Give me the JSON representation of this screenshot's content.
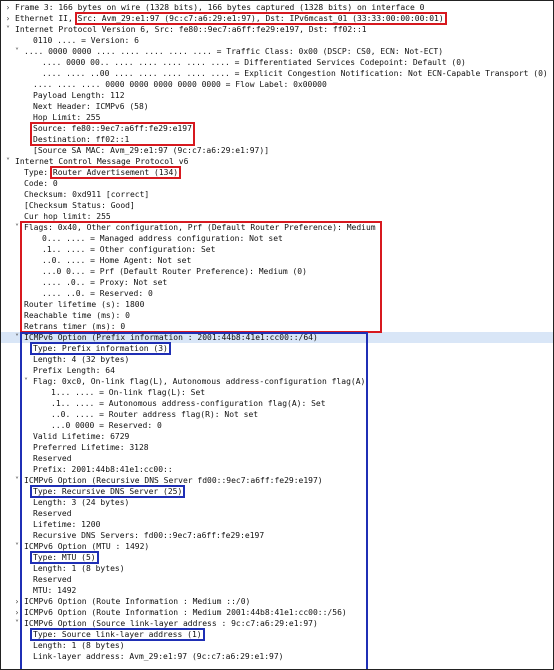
{
  "colors": {
    "highlight_red": "#d7191f",
    "highlight_blue": "#1f2fb5",
    "selected_row": "#d9e6f7"
  },
  "icons": {
    "collapsed": "chevron-right-icon",
    "expanded": "chevron-down-icon"
  },
  "tree": [
    {
      "arrow": "collapsed",
      "text": "Frame 3: 166 bytes on wire (1328 bits), 166 bytes captured (1328 bits) on interface 0"
    },
    {
      "arrow": "collapsed",
      "text": "Ethernet II, Src: Avm_29:e1:97 (9c:c7:a6:29:e1:97), Dst: IPv6mcast_01 (33:33:00:00:00:01)"
    },
    {
      "arrow": "expanded",
      "text": "Internet Protocol Version 6, Src: fe80::9ec7:a6ff:fe29:e197, Dst: ff02::1"
    },
    {
      "text": "0110 .... = Version: 6"
    },
    {
      "arrow": "expanded",
      "text": ".... 0000 0000 .... .... .... .... .... = Traffic Class: 0x00 (DSCP: CS0, ECN: Not-ECT)"
    },
    {
      "text": ".... 0000 00.. .... .... .... .... .... = Differentiated Services Codepoint: Default (0)"
    },
    {
      "text": ".... .... ..00 .... .... .... .... .... = Explicit Congestion Notification: Not ECN-Capable Transport (0)"
    },
    {
      "text": ".... .... .... 0000 0000 0000 0000 0000 = Flow Label: 0x00000"
    },
    {
      "text": "Payload Length: 112"
    },
    {
      "text": "Next Header: ICMPv6 (58)"
    },
    {
      "text": "Hop Limit: 255"
    },
    {
      "text": "Source: fe80::9ec7:a6ff:fe29:e197"
    },
    {
      "text": "Destination: ff02::1"
    },
    {
      "text": "[Source SA MAC: Avm_29:e1:97 (9c:c7:a6:29:e1:97)]"
    },
    {
      "arrow": "expanded",
      "text": "Internet Control Message Protocol v6"
    },
    {
      "text": "Type: Router Advertisement (134)"
    },
    {
      "text": "Code: 0"
    },
    {
      "text": "Checksum: 0xd911 [correct]"
    },
    {
      "text": "[Checksum Status: Good]"
    },
    {
      "text": "Cur hop limit: 255"
    },
    {
      "arrow": "expanded",
      "text": "Flags: 0x40, Other configuration, Prf (Default Router Preference): Medium"
    },
    {
      "text": "0... .... = Managed address configuration: Not set"
    },
    {
      "text": ".1.. .... = Other configuration: Set"
    },
    {
      "text": "..0. .... = Home Agent: Not set"
    },
    {
      "text": "...0 0... = Prf (Default Router Preference): Medium (0)"
    },
    {
      "text": ".... .0.. = Proxy: Not set"
    },
    {
      "text": ".... ..0. = Reserved: 0"
    },
    {
      "text": "Router lifetime (s): 1800"
    },
    {
      "text": "Reachable time (ms): 0"
    },
    {
      "text": "Retrans timer (ms): 0"
    },
    {
      "arrow": "expanded",
      "text": "ICMPv6 Option (Prefix information : 2001:44b8:41e1:cc00::/64)"
    },
    {
      "text": "Type: Prefix information (3)"
    },
    {
      "text": "Length: 4 (32 bytes)"
    },
    {
      "text": "Prefix Length: 64"
    },
    {
      "arrow": "expanded",
      "text": "Flag: 0xc0, On-link flag(L), Autonomous address-configuration flag(A)"
    },
    {
      "text": "1... .... = On-link flag(L): Set"
    },
    {
      "text": ".1.. .... = Autonomous address-configuration flag(A): Set"
    },
    {
      "text": "..0. .... = Router address flag(R): Not set"
    },
    {
      "text": "...0 0000 = Reserved: 0"
    },
    {
      "text": "Valid Lifetime: 6729"
    },
    {
      "text": "Preferred Lifetime: 3128"
    },
    {
      "text": "Reserved"
    },
    {
      "text": "Prefix: 2001:44b8:41e1:cc00::"
    },
    {
      "arrow": "expanded",
      "text": "ICMPv6 Option (Recursive DNS Server fd00::9ec7:a6ff:fe29:e197)"
    },
    {
      "text": "Type: Recursive DNS Server (25)"
    },
    {
      "text": "Length: 3 (24 bytes)"
    },
    {
      "text": "Reserved"
    },
    {
      "text": "Lifetime: 1200"
    },
    {
      "text": "Recursive DNS Servers: fd00::9ec7:a6ff:fe29:e197"
    },
    {
      "arrow": "expanded",
      "text": "ICMPv6 Option (MTU : 1492)"
    },
    {
      "text": "Type: MTU (5)"
    },
    {
      "text": "Length: 1 (8 bytes)"
    },
    {
      "text": "Reserved"
    },
    {
      "text": "MTU: 1492"
    },
    {
      "arrow": "collapsed",
      "text": "ICMPv6 Option (Route Information : Medium ::/0)"
    },
    {
      "arrow": "collapsed",
      "text": "ICMPv6 Option (Route Information : Medium 2001:44b8:41e1:cc00::/56)"
    },
    {
      "arrow": "expanded",
      "text": "ICMPv6 Option (Source link-layer address : 9c:c7:a6:29:e1:97)"
    },
    {
      "text": "Type: Source link-layer address (1)"
    },
    {
      "text": "Length: 1 (8 bytes)"
    },
    {
      "text": "Link-layer address: Avm_29:e1:97 (9c:c7:a6:29:e1:97)"
    }
  ]
}
